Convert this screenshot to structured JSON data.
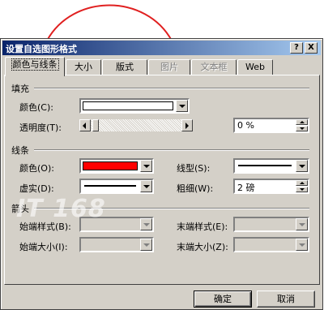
{
  "dialog": {
    "title": "设置自选图形格式",
    "help_button": "?",
    "close_button": "X"
  },
  "tabs": [
    {
      "label": "颜色与线条",
      "active": true
    },
    {
      "label": "大小"
    },
    {
      "label": "版式"
    },
    {
      "label": "图片",
      "disabled": true
    },
    {
      "label": "文本框",
      "disabled": true
    },
    {
      "label": "Web"
    }
  ],
  "fill": {
    "section": "填充",
    "color_label": "颜色(C):",
    "color_value": "#ffffff",
    "transparency_label": "透明度(T):",
    "transparency_value": "0 %"
  },
  "line": {
    "section": "线条",
    "color_label": "颜色(O):",
    "color_value": "#ff0000",
    "dash_label": "虚实(D):",
    "style_label": "线型(S):",
    "weight_label": "粗细(W):",
    "weight_value": "2 磅"
  },
  "arrows": {
    "section": "箭头",
    "begin_style_label": "始端样式(B):",
    "begin_size_label": "始端大小(I):",
    "end_style_label": "末端样式(E):",
    "end_size_label": "末端大小(Z):"
  },
  "buttons": {
    "ok": "确定",
    "cancel": "取消"
  },
  "watermark": "IT 168",
  "decoration": {
    "arc_color": "#e02020"
  }
}
